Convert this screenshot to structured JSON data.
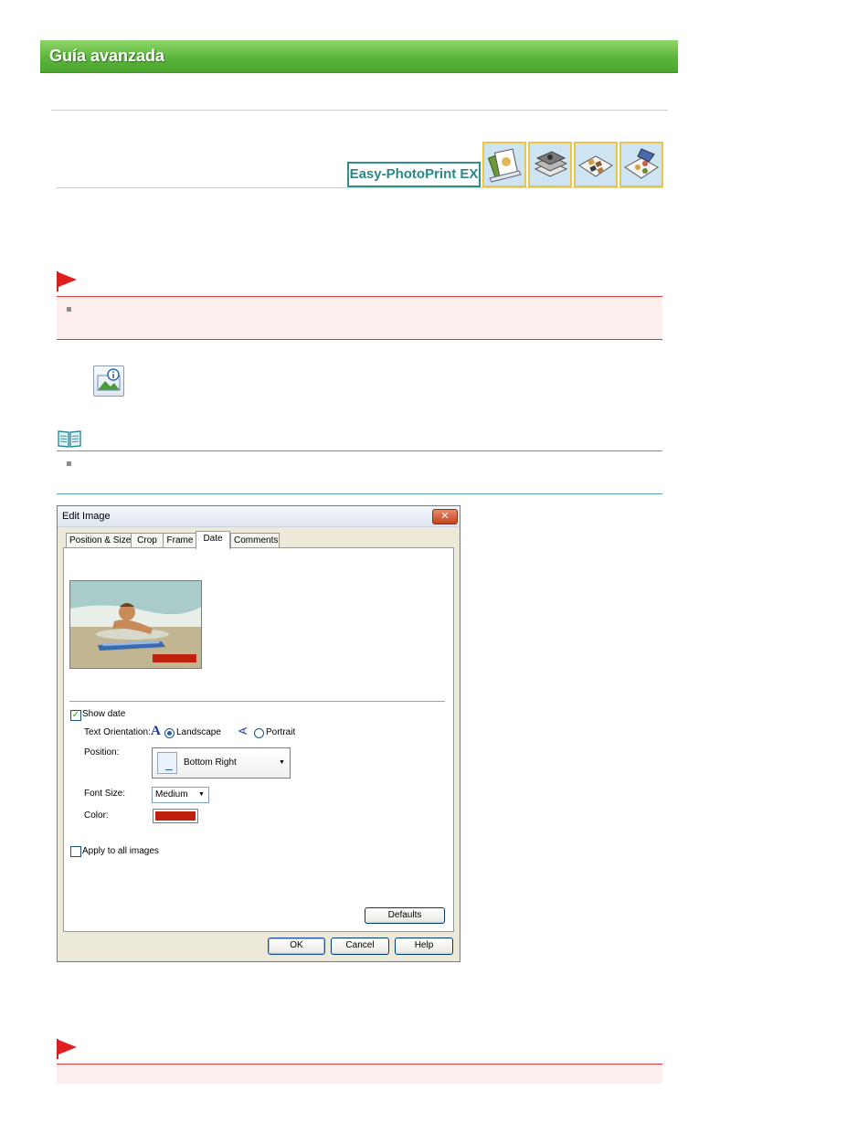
{
  "header": {
    "title": "Guía avanzada"
  },
  "product": {
    "badge": "Easy-PhotoPrint EX"
  },
  "tiles": [
    {
      "icon": "album-book-icon"
    },
    {
      "icon": "photo-stack-icon"
    },
    {
      "icon": "layout-sheets-icon"
    },
    {
      "icon": "stickers-sheet-icon"
    }
  ],
  "dialog": {
    "title": "Edit Image",
    "close_glyph": "✕",
    "tabs": [
      "Position & Size",
      "Crop",
      "Frame",
      "Date",
      "Comments"
    ],
    "active_tab": "Date",
    "show_date": {
      "label": "Show date",
      "checked": true
    },
    "text_orientation": {
      "label": "Text Orientation:",
      "landscape_glyph": "A",
      "landscape": "Landscape",
      "portrait_glyph": "A",
      "portrait": "Portrait",
      "selected": "Landscape"
    },
    "position": {
      "label": "Position:",
      "value": "Bottom Right"
    },
    "font_size": {
      "label": "Font Size:",
      "value": "Medium"
    },
    "color": {
      "label": "Color:",
      "value": "#c0200e"
    },
    "apply_all": {
      "label": "Apply to all images",
      "checked": false
    },
    "buttons": {
      "defaults": "Defaults",
      "ok": "OK",
      "cancel": "Cancel",
      "help": "Help"
    },
    "checkmark": "✓",
    "caret": "▼"
  },
  "colors": {
    "banner": "#5cb53c",
    "important": "#d43a3a",
    "note": "#5aa0b0",
    "badge": "#2a8888"
  }
}
